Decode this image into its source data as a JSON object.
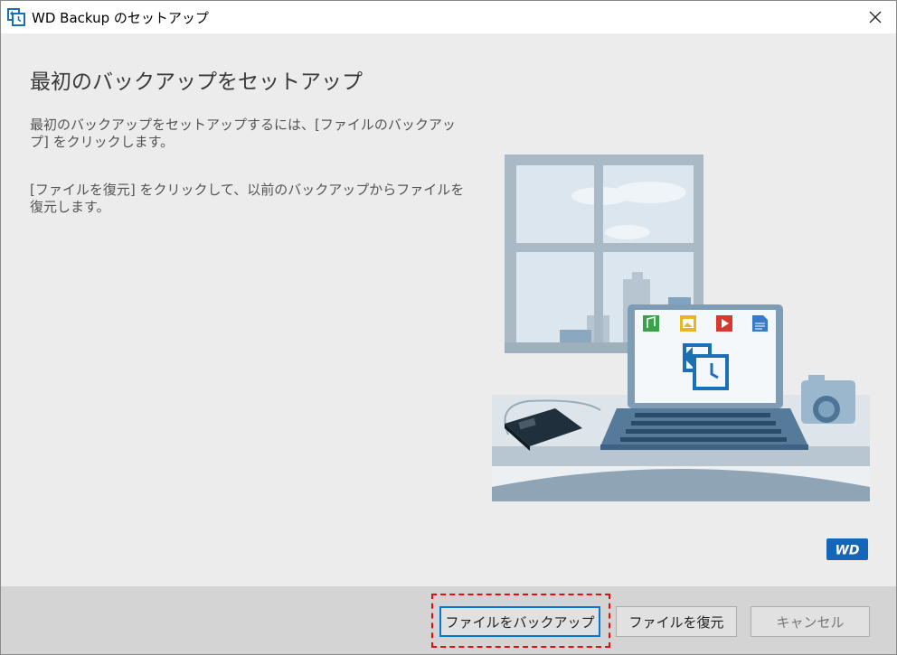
{
  "window": {
    "title": "WD Backup のセットアップ",
    "icon": "backup-restore-icon",
    "close_icon": "close-icon"
  },
  "main": {
    "heading": "最初のバックアップをセットアップ",
    "paragraph1": "最初のバックアップをセットアップするには、[ファイルのバックアップ] をクリックします。",
    "paragraph2": "[ファイルを復元] をクリックして、以前のバックアップからファイルを復元します。"
  },
  "illustration": {
    "icons": [
      "music-icon",
      "image-icon",
      "video-icon",
      "document-icon",
      "backup-restore-icon",
      "external-drive-icon",
      "camera-icon",
      "laptop-icon"
    ]
  },
  "brand": {
    "logo_text": "WD",
    "color": "#1565b8"
  },
  "buttons": {
    "backup": "ファイルをバックアップ",
    "restore": "ファイルを復元",
    "cancel": "キャンセル"
  },
  "colors": {
    "accent": "#0078d7",
    "highlight": "#e01010",
    "icon_blue": "#1a6fb5"
  }
}
